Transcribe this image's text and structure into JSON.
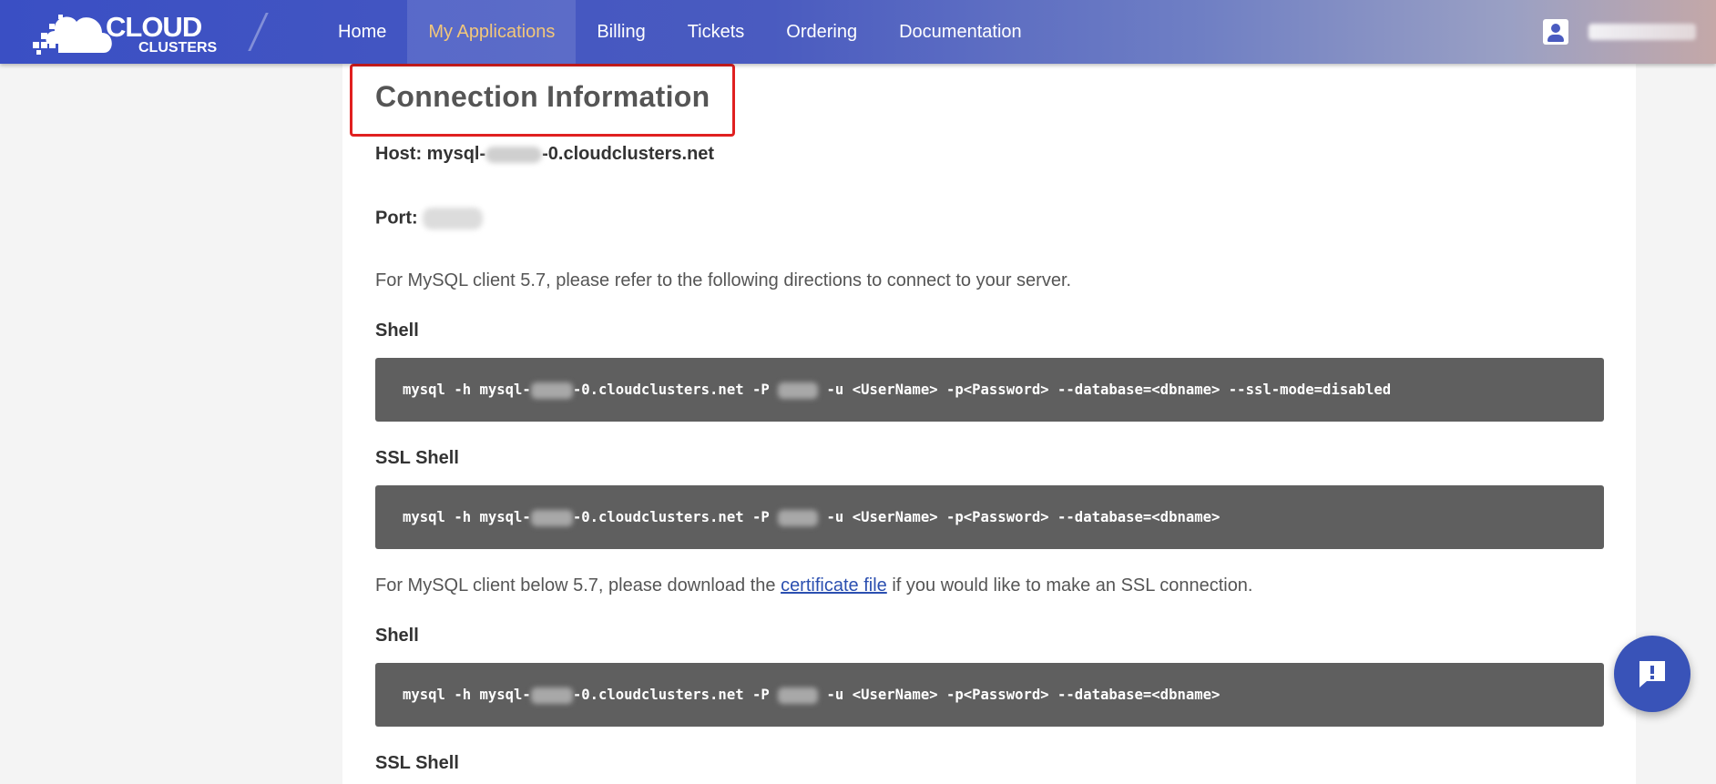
{
  "brand": {
    "line1": "CLOUD",
    "line2": "CLUSTERS",
    "colors": {
      "primary": "#3a4fc4",
      "active_nav_text": "#f2c77a",
      "highlight_border": "#e02020",
      "code_bg": "#5f5f5f",
      "fab": "#3953b8"
    }
  },
  "nav": {
    "items": [
      {
        "label": "Home"
      },
      {
        "label": "My Applications",
        "active": true
      },
      {
        "label": "Billing"
      },
      {
        "label": "Tickets"
      },
      {
        "label": "Ordering"
      },
      {
        "label": "Documentation"
      }
    ]
  },
  "user": {
    "icon": "account-box-icon",
    "name_redacted": true
  },
  "content": {
    "title": "Connection Information",
    "host_label": "Host:",
    "host_prefix": "mysql-",
    "host_suffix": "-0.cloudclusters.net",
    "port_label": "Port:",
    "intro_57": "For MySQL client 5.7, please refer to the following directions to connect to your server.",
    "shell_label": "Shell",
    "ssl_shell_label": "SSL Shell",
    "cmd1_a": "mysql -h mysql-",
    "cmd1_b": "-0.cloudclusters.net -P ",
    "cmd1_c": " -u <UserName> -p<Password> --database=<dbname> --ssl-mode=disabled",
    "cmd2_a": "mysql -h mysql-",
    "cmd2_b": "-0.cloudclusters.net -P ",
    "cmd2_c": " -u <UserName> -p<Password> --database=<dbname>",
    "intro_below_pre": "For MySQL client below 5.7, please download the ",
    "cert_link": "certificate file",
    "intro_below_post": " if you would like to make an SSL connection.",
    "shell_label_2": "Shell",
    "cmd3_a": "mysql -h mysql-",
    "cmd3_b": "-0.cloudclusters.net -P ",
    "cmd3_c": " -u <UserName> -p<Password> --database=<dbname>",
    "ssl_shell_label_2": "SSL Shell"
  },
  "fab": {
    "icon": "feedback-chat-icon"
  }
}
